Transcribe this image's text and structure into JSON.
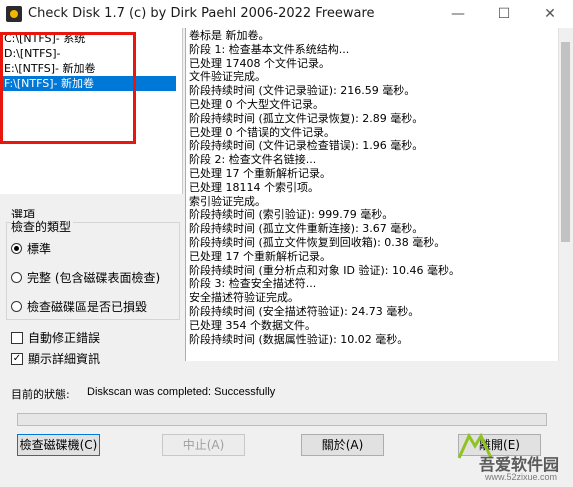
{
  "window": {
    "title": "Check Disk 1.7  (c) by Dirk Paehl  2006-2022 Freeware",
    "minimize_glyph": "—",
    "maximize_glyph": "☐",
    "close_glyph": "✕"
  },
  "drives": [
    {
      "label": "C:\\[NTFS]- 系统",
      "selected": false
    },
    {
      "label": "D:\\[NTFS]-",
      "selected": false
    },
    {
      "label": "E:\\[NTFS]- 新加卷",
      "selected": false
    },
    {
      "label": "F:\\[NTFS]- 新加卷",
      "selected": true
    }
  ],
  "log_lines": [
    "卷标是 新加卷。",
    "阶段 1: 检查基本文件系统结构...",
    "已处理 17408 个文件记录。",
    "文件验证完成。",
    "阶段持续时间 (文件记录验证): 216.59 毫秒。",
    "已处理 0 个大型文件记录。",
    "阶段持续时间 (孤立文件记录恢复): 2.89 毫秒。",
    "已处理 0 个错误的文件记录。",
    "阶段持续时间 (文件记录检查错误): 1.96 毫秒。",
    "阶段 2: 检查文件名链接...",
    "已处理 17 个重新解析记录。",
    "已处理 18114 个索引项。",
    "索引验证完成。",
    "阶段持续时间 (索引验证): 999.79 毫秒。",
    "阶段持续时间 (孤立文件重新连接): 3.67 毫秒。",
    "阶段持续时间 (孤立文件恢复到回收箱): 0.38 毫秒。",
    "已处理 17 个重新解析记录。",
    "阶段持续时间 (重分析点和对象 ID 验证): 10.46 毫秒。",
    "阶段 3: 检查安全描述符...",
    "安全描述符验证完成。",
    "阶段持续时间 (安全描述符验证): 24.73 毫秒。",
    "已处理 354 个数据文件。",
    "阶段持续时间 (数据属性验证): 10.02 毫秒。"
  ],
  "options": {
    "title": "選項",
    "check_type_label": "檢查的類型",
    "radios": [
      {
        "label": "標準",
        "checked": true
      },
      {
        "label": "完整 (包含磁碟表面檢查)",
        "checked": false
      },
      {
        "label": "檢查磁碟區是否已損毀",
        "checked": false
      }
    ],
    "checkboxes": [
      {
        "label": "自動修正錯誤",
        "checked": false
      },
      {
        "label": "顯示詳細資訊",
        "checked": true
      }
    ]
  },
  "status": {
    "label": "目前的狀態:",
    "value": "Diskscan was completed: Successfully",
    "progress": 0
  },
  "buttons": {
    "check_disk": "檢查磁碟機(C)",
    "stop": "中止(A)",
    "about": "關於(A)",
    "exit": "離開(E)"
  },
  "watermark": {
    "text": "吾爱软件园",
    "url": "www.52zixue.com"
  },
  "colors": {
    "selection": "#0078d7",
    "highlight_box": "#e8160c"
  }
}
